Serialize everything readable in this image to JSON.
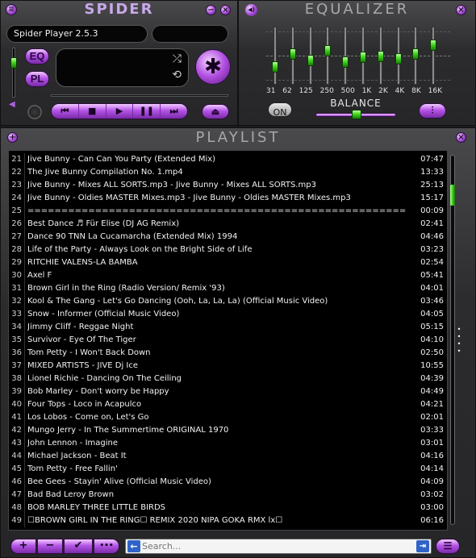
{
  "player": {
    "title": "SPIDER",
    "track_display": "Spider Player 2.5.3",
    "eq_button": "EQ",
    "pl_button": "PL",
    "shuffle_symbol": "⤮",
    "repeat_symbol": "⟲",
    "logo_symbol": "✱",
    "minimize_symbol": "−",
    "close_symbol": "×",
    "prev_symbol": "⏮",
    "stop_symbol": "■",
    "play_symbol": "▶",
    "pause_symbol": "❚❚",
    "next_symbol": "⏭",
    "eject_symbol": "⏏",
    "volume_level": 0.22,
    "seek_position": 0.0
  },
  "equalizer": {
    "title": "EQUALIZER",
    "on_label": "ON",
    "balance_label": "BALANCE",
    "balance_value": 0.5,
    "speaker_symbol": "◀)",
    "close_symbol": "×",
    "presets_symbol": "⫶",
    "bands": [
      {
        "label": "31",
        "level": 0.28
      },
      {
        "label": "62",
        "level": 0.55
      },
      {
        "label": "125",
        "level": 0.42
      },
      {
        "label": "250",
        "level": 0.62
      },
      {
        "label": "500",
        "level": 0.38
      },
      {
        "label": "1K",
        "level": 0.48
      },
      {
        "label": "2K",
        "level": 0.5
      },
      {
        "label": "4K",
        "level": 0.44
      },
      {
        "label": "8K",
        "level": 0.56
      },
      {
        "label": "16K",
        "level": 0.75
      }
    ]
  },
  "playlist": {
    "title": "PLAYLIST",
    "add_symbol": "+",
    "close_symbol": "×",
    "search_placeholder": "Search...",
    "rows": [
      {
        "num": "21",
        "title": "Jive Bunny - Can Can You Party (Extended Mix)",
        "dur": "07:47"
      },
      {
        "num": "22",
        "title": "The Jive Bunny Compilation No.  1.mp4",
        "dur": "13:33"
      },
      {
        "num": "23",
        "title": "Jive Bunny - Mixes ALL SORTS.mp3 - Jive Bunny - Mixes ALL SORTS.mp3",
        "dur": "25:13"
      },
      {
        "num": "24",
        "title": "Jive Bunny - Oldies MASTER Mixes.mp3 - Jive Bunny - Oldies MASTER Mixes.mp3",
        "dur": "15:17"
      },
      {
        "num": "25",
        "title": "========================================================",
        "dur": "00:09"
      },
      {
        "num": "26",
        "title": "Best Dance ♬ Für Elise (DJ AG Remix)",
        "dur": "02:41"
      },
      {
        "num": "27",
        "title": "Dance 90 TNN La Cucamarcha (Extended Mix) 1994",
        "dur": "04:46"
      },
      {
        "num": "28",
        "title": "Life of the Party - Always Look on the Bright Side of Life",
        "dur": "03:23"
      },
      {
        "num": "29",
        "title": "RITCHIE VALENS-LA BAMBA",
        "dur": "02:54"
      },
      {
        "num": "30",
        "title": "Axel F",
        "dur": "05:41"
      },
      {
        "num": "31",
        "title": "Brown Girl in the Ring (Radio Version/ Remix '93)",
        "dur": "04:01"
      },
      {
        "num": "32",
        "title": "Kool & The Gang - Let's Go Dancing (Ooh, La, La, La) (Official Music Video)",
        "dur": "03:46"
      },
      {
        "num": "33",
        "title": "Snow - Informer (Official Music Video)",
        "dur": "04:05"
      },
      {
        "num": "34",
        "title": "Jimmy Cliff - Reggae Night",
        "dur": "05:15"
      },
      {
        "num": "35",
        "title": "Survivor - Eye Of The Tiger",
        "dur": "04:10"
      },
      {
        "num": "36",
        "title": "Tom Petty - I Won't Back Down",
        "dur": "02:50"
      },
      {
        "num": "37",
        "title": "MIXED ARTISTS - JIVE Dj Ice",
        "dur": "10:55"
      },
      {
        "num": "38",
        "title": "Lionel Richie - Dancing On The Ceiling",
        "dur": "04:39"
      },
      {
        "num": "39",
        "title": "Bob Marley - Don't worry be Happy",
        "dur": "04:49"
      },
      {
        "num": "40",
        "title": "Four Tops - Loco in Acapulco",
        "dur": "04:21"
      },
      {
        "num": "41",
        "title": "Los Lobos - Come on, Let's Go",
        "dur": "02:01"
      },
      {
        "num": "42",
        "title": "Mungo Jerry - In The Summertime ORIGINAL 1970",
        "dur": "03:33"
      },
      {
        "num": "43",
        "title": "John Lennon - Imagine",
        "dur": "03:01"
      },
      {
        "num": "44",
        "title": "Michael Jackson - Beat It",
        "dur": "04:16"
      },
      {
        "num": "45",
        "title": "Tom Petty - Free Fallin'",
        "dur": "04:14"
      },
      {
        "num": "46",
        "title": "Bee Gees - Stayin' Alive (Official Music Video)",
        "dur": "04:09"
      },
      {
        "num": "47",
        "title": "Bad Bad Leroy Brown",
        "dur": "03:02"
      },
      {
        "num": "48",
        "title": "BOB MARLEY THREE LITTLE BIRDS",
        "dur": "03:00"
      },
      {
        "num": "49",
        "title": "☐BROWN GIRL IN THE RING☐ REMIX 2020 NIPA GOKA RMX lx☐",
        "dur": "06:16"
      }
    ],
    "scroll_position": 0.2,
    "toolbar": {
      "add": "+",
      "remove": "−",
      "select": "✔",
      "more": "•••",
      "search_nav": "⇥",
      "list_menu": "☰"
    }
  }
}
